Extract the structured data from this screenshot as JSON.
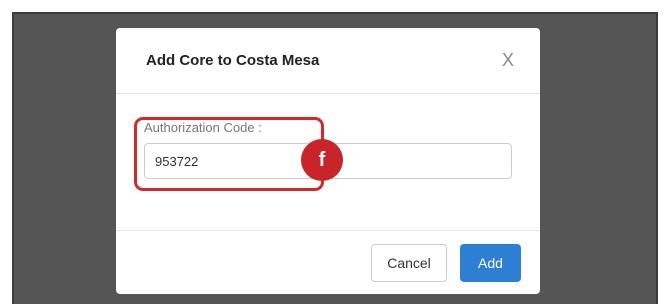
{
  "modal": {
    "title": "Add Core to Costa Mesa",
    "close_label": "X"
  },
  "form": {
    "auth_code_label": "Authorization Code :",
    "auth_code_value": "953722"
  },
  "annotation": {
    "marker_letter": "f",
    "highlight_color": "#d6282b"
  },
  "footer": {
    "cancel_label": "Cancel",
    "add_label": "Add"
  },
  "colors": {
    "primary": "#2d7fd3",
    "backdrop": "#555555"
  }
}
